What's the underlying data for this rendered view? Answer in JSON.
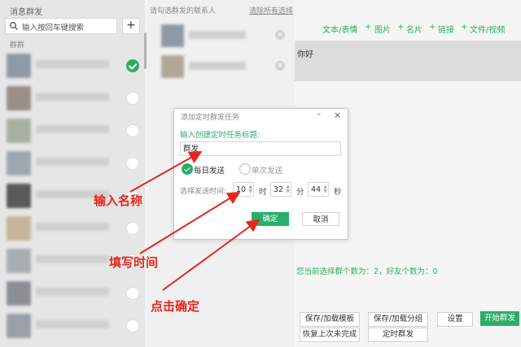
{
  "left_panel": {
    "title": "消息群发",
    "search_placeholder": "输入按回车键搜索",
    "add_label": "+",
    "group_label": "群群"
  },
  "contacts": [
    {
      "checked": true,
      "color": "#8f9aa8"
    },
    {
      "checked": false,
      "color": "#9a8e86"
    },
    {
      "checked": false,
      "color": "#a8b0a2"
    },
    {
      "checked": false,
      "color": "#9ea6b2"
    },
    {
      "checked": false,
      "color": "#5a5a5a"
    },
    {
      "checked": false,
      "color": "#c7b49a"
    },
    {
      "checked": false,
      "color": "#a9aeb3"
    },
    {
      "checked": false,
      "color": "#8c8f95"
    },
    {
      "checked": false,
      "color": "#9aa0a6"
    }
  ],
  "middle_panel": {
    "hint": "请勾选群发的联系人",
    "clear_label": "清除所有选择",
    "selected": [
      {
        "color": "#8f9aa8"
      },
      {
        "color": "#b1a89a"
      }
    ]
  },
  "right_panel": {
    "toolbar": [
      "文本/表情",
      "图片",
      "名片",
      "链接",
      "文件/视频"
    ],
    "toolbar_sep": "+",
    "message_text": "你好",
    "status": "您当前选择群个数为：2，好友个数为：0",
    "buttons": {
      "save_template": "保存/加载模板",
      "save_group": "保存/加载分组",
      "settings": "设置",
      "start": "开始群发",
      "restore": "恢复上次未完成",
      "scheduled": "定时群发"
    },
    "colors": {
      "accent": "#2aae67"
    }
  },
  "dialog": {
    "title": "添加定时群发任务",
    "minimize": "–",
    "close": "×",
    "task_label": "输入创建定时任务标题:",
    "task_value": "群发",
    "daily_label": "每日发送",
    "once_label": "单次发送",
    "time_label": "选择发送时间:",
    "hour": "10",
    "hour_unit": "时",
    "minute": "32",
    "minute_unit": "分",
    "second": "44",
    "second_unit": "秒",
    "ok": "确定",
    "cancel": "取消"
  },
  "annotations": {
    "name": "输入名称",
    "time": "填写时间",
    "confirm": "点击确定",
    "color": "#e8241b"
  }
}
